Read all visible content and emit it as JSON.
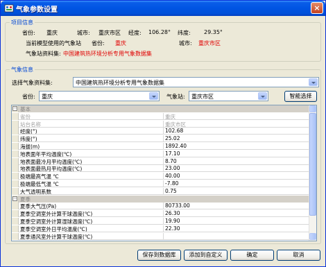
{
  "window": {
    "title": "气象参数设置",
    "close_label": "×"
  },
  "project": {
    "legend": "项目信息",
    "province_label": "省份:",
    "province": "重庆",
    "city_label": "城市:",
    "city": "重庆市区",
    "longitude_label": "经度:",
    "longitude": "106.28°",
    "latitude_label": "纬度:",
    "latitude": "29.35°",
    "current_station_label": "当前模型使用的气象站",
    "station_province_label": "省份:",
    "station_province": "重庆",
    "station_city_label": "城市:",
    "station_city": "重庆市区",
    "dataset_label": "气象站资料集:",
    "dataset": "中国建筑热环境分析专用气象数据集"
  },
  "weather": {
    "legend": "气象信息",
    "select_dataset_label": "选择气象资料集:",
    "dataset_value": "中国建筑热环境分析专用气象数据集",
    "province_label": "省份:",
    "province_value": "重庆",
    "station_label": "气象站:",
    "station_value": "重庆市区",
    "smart_select_label": "智能选择"
  },
  "grid": {
    "rows": [
      {
        "type": "cat",
        "name": "基本",
        "value": ""
      },
      {
        "type": "ro",
        "name": "省份",
        "value": "重庆"
      },
      {
        "type": "ro",
        "name": "站台名称",
        "value": "重庆市区"
      },
      {
        "type": "",
        "name": "经度(°)",
        "value": "102.68"
      },
      {
        "type": "",
        "name": "纬度(°)",
        "value": "25.02"
      },
      {
        "type": "",
        "name": "海拔(m)",
        "value": "1892.40"
      },
      {
        "type": "",
        "name": "地表面年平均温度(℃)",
        "value": "17.10"
      },
      {
        "type": "",
        "name": "地表面最冷月平均温度(℃)",
        "value": "8.70"
      },
      {
        "type": "",
        "name": "地表面最热月平均温度(℃)",
        "value": "23.00"
      },
      {
        "type": "",
        "name": "极端最高气温 ℃",
        "value": "40.00"
      },
      {
        "type": "",
        "name": "极端最低气温 ℃",
        "value": "-7.80"
      },
      {
        "type": "",
        "name": "大气透明系数",
        "value": "0.75"
      },
      {
        "type": "cat",
        "name": "夏季",
        "value": ""
      },
      {
        "type": "",
        "name": "夏季大气压(Pa)",
        "value": "80733.00"
      },
      {
        "type": "",
        "name": "夏季空调室外计算干球温度(℃)",
        "value": "26.30"
      },
      {
        "type": "",
        "name": "夏季空调室外计算湿球温度(℃)",
        "value": "19.90"
      },
      {
        "type": "",
        "name": "夏季空调室外日平均温度(℃)",
        "value": "22.30"
      },
      {
        "type": "",
        "name": "夏季通风室外计算干球温度(℃)",
        "value": ""
      }
    ]
  },
  "buttons": {
    "save_db": "保存到数据库",
    "add_custom": "添加到自定义",
    "ok": "确定",
    "cancel": "取消"
  }
}
